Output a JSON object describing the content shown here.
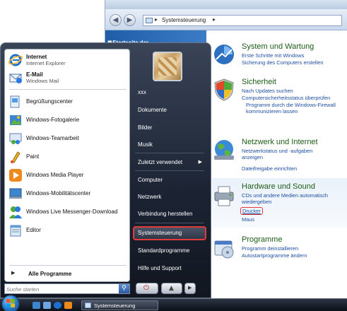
{
  "control_panel": {
    "address": {
      "path": "Systemsteuerung"
    },
    "sidebar": {
      "home": "Startseite der"
    },
    "categories": [
      {
        "title": "System und Wartung",
        "links": [
          "Erste Schritte mit Windows",
          "Sicherung des Computers erstellen"
        ],
        "icon": "system-maintenance-icon"
      },
      {
        "title": "Sicherheit",
        "links": [
          "Nach Updates suchen",
          "Computersicherheitsstatus überprüfen",
          "Programm durch die Windows-Firewall kommunizieren lassen"
        ],
        "icon": "shield-icon"
      },
      {
        "title": "Netzwerk und Internet",
        "links": [
          "Netzwerkstatus und -aufgaben anzeigen",
          "Dateifreigabe einrichten"
        ],
        "icon": "network-globe-icon"
      },
      {
        "title": "Hardware und Sound",
        "links": [
          "CDs und andere Medien automatisch wiedergeben",
          "Drucker",
          "Maus"
        ],
        "icon": "printer-icon"
      },
      {
        "title": "Programme",
        "links": [
          "Programm deinstallieren",
          "Autostartprogramme ändern"
        ],
        "icon": "programs-icon"
      }
    ]
  },
  "start_menu": {
    "pinned": [
      {
        "title": "Internet",
        "subtitle": "Internet Explorer",
        "icon": "internet-explorer-icon"
      },
      {
        "title": "E-Mail",
        "subtitle": "Windows Mail",
        "icon": "mail-icon"
      }
    ],
    "recent": [
      {
        "label": "Begrüßungscenter",
        "icon": "welcome-center-icon"
      },
      {
        "label": "Windows-Fotogalerie",
        "icon": "photo-gallery-icon"
      },
      {
        "label": "Windows-Teamarbeit",
        "icon": "meeting-space-icon"
      },
      {
        "label": "Paint",
        "icon": "paint-icon"
      },
      {
        "label": "Windows Media Player",
        "icon": "media-player-icon"
      },
      {
        "label": "Windows-Mobilitätscenter",
        "icon": "mobility-center-icon"
      },
      {
        "label": "Windows Live Messenger-Download",
        "icon": "messenger-icon"
      },
      {
        "label": "Editor",
        "icon": "notepad-icon"
      }
    ],
    "all_programs": "Alle Programme",
    "search_placeholder": "Suche starten",
    "right_items": {
      "user": "xxx",
      "documents": "Dokumente",
      "pictures": "Bilder",
      "music": "Musik",
      "recent": "Zuletzt verwendet",
      "computer": "Computer",
      "network": "Netzwerk",
      "connect": "Verbindung herstellen",
      "control_panel": "Systemsteuerung",
      "default_programs": "Standardprogramme",
      "help": "Hilfe und Support"
    },
    "highlight_color": "#e23b3b"
  },
  "taskbar": {
    "window_button": "Systemsteuerung"
  }
}
